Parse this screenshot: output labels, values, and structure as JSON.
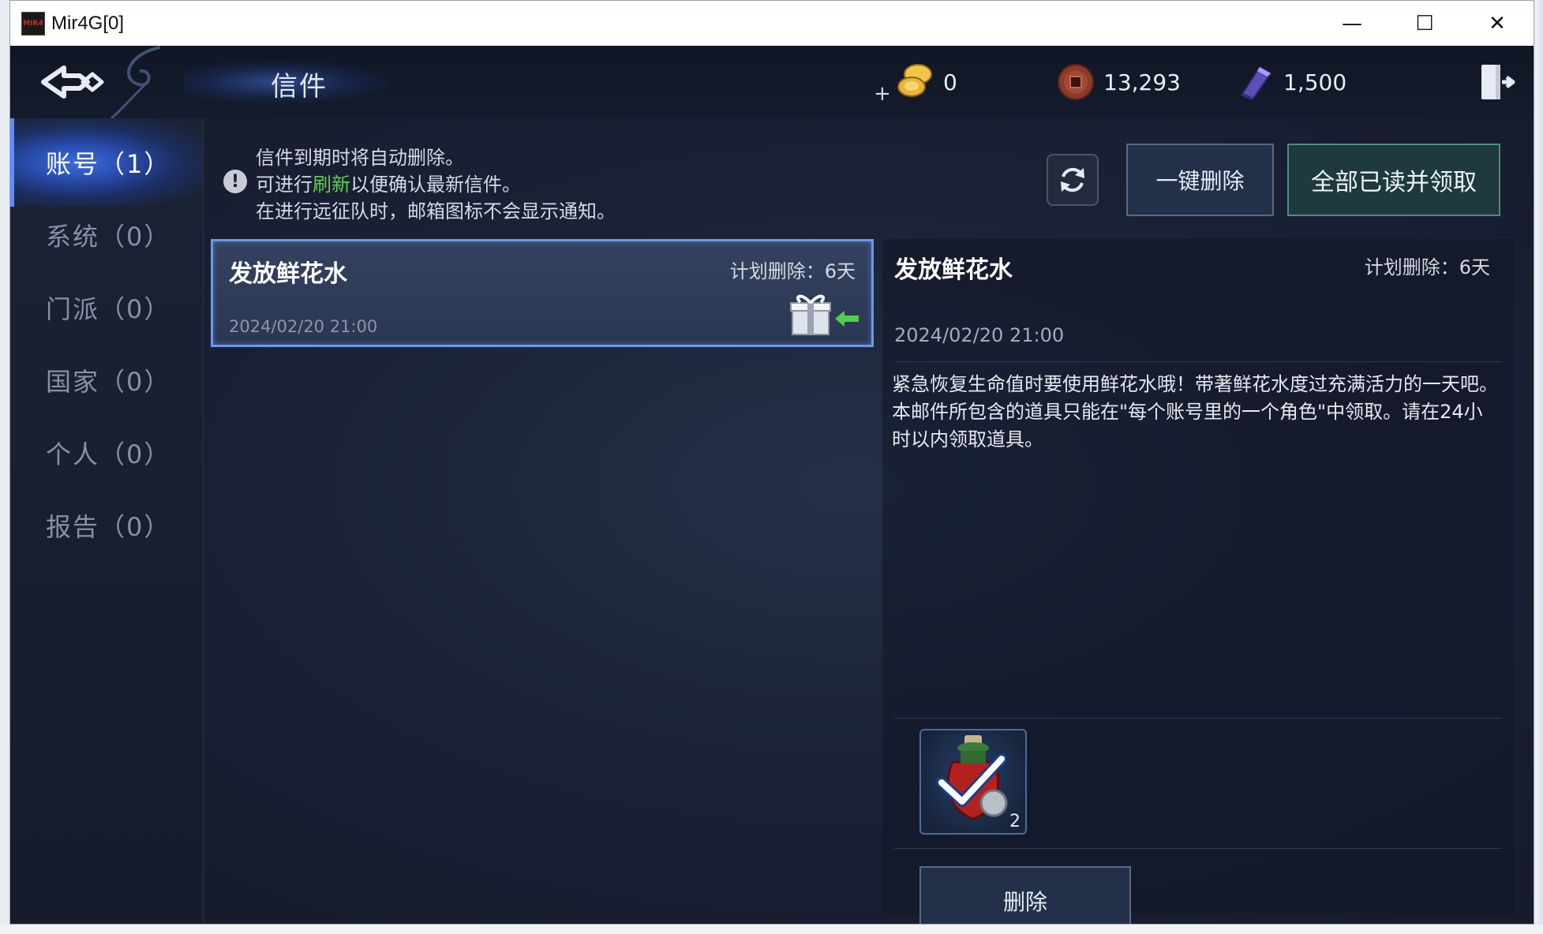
{
  "window": {
    "title": "Mir4G[0]",
    "controls": {
      "minimize": "—",
      "maximize": "☐",
      "close": "✕"
    }
  },
  "topbar": {
    "title": "信件",
    "currencies": [
      {
        "name": "gold-coins",
        "value": "0"
      },
      {
        "name": "copper",
        "value": "13,293"
      },
      {
        "name": "darksteel",
        "value": "1,500"
      }
    ]
  },
  "sidebar": {
    "items": [
      {
        "label": "账号（1）",
        "active": true
      },
      {
        "label": "系统（0）",
        "active": false
      },
      {
        "label": "门派（0）",
        "active": false
      },
      {
        "label": "国家（0）",
        "active": false
      },
      {
        "label": "个人（0）",
        "active": false
      },
      {
        "label": "报告（0）",
        "active": false
      }
    ]
  },
  "notice": {
    "line1": "信件到期时将自动删除。",
    "line2_pre": "可进行",
    "line2_hl": "刷新",
    "line2_post": "以便确认最新信件。",
    "line3": "在进行远征队时，邮箱图标不会显示通知。"
  },
  "actions": {
    "delete_all": "一键删除",
    "read_claim_all": "全部已读并领取"
  },
  "mail_list": [
    {
      "subject": "发放鲜花水",
      "expire": "计划删除：6天",
      "date": "2024/02/20 21:00"
    }
  ],
  "detail": {
    "subject": "发放鲜花水",
    "expire": "计划删除：6天",
    "date": "2024/02/20 21:00",
    "body": "紧急恢复生命值时要使用鲜花水哦！带著鲜花水度过充满活力的一天吧。本邮件所包含的道具只能在\"每个账号里的一个角色\"中领取。请在24小时以内领取道具。",
    "attachment": {
      "name": "鲜花水",
      "quantity": "2",
      "claimed": true
    },
    "delete_label": "删除"
  }
}
